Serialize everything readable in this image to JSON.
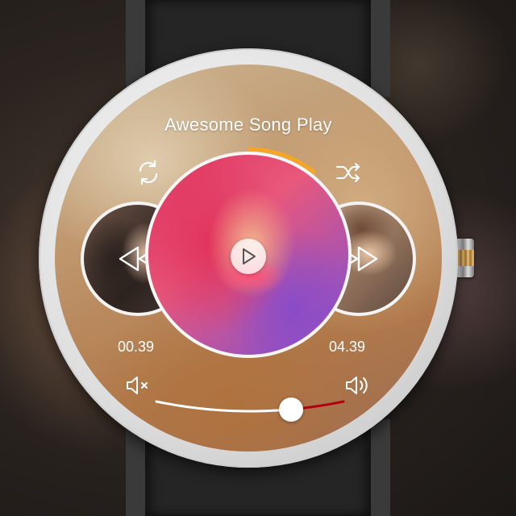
{
  "title": "Awesome Song Play",
  "controls": {
    "repeat_icon": "repeat-icon",
    "shuffle_icon": "shuffle-icon",
    "prev_icon": "rewind-icon",
    "next_icon": "fast-forward-icon",
    "play_icon": "play-icon",
    "volume_mute_icon": "volume-mute-icon",
    "volume_loud_icon": "volume-loud-icon"
  },
  "time": {
    "elapsed": "00.39",
    "total": "04.39"
  },
  "progress_fraction": 0.11,
  "volume_fraction": 0.72,
  "colors": {
    "progress_accent": "#f5a623",
    "volume_accent": "#b00010",
    "track_base": "#ffffff"
  }
}
